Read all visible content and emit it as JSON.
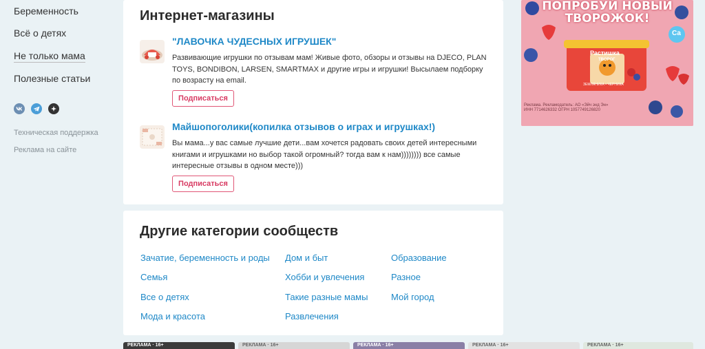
{
  "sidebar": {
    "links": [
      "Беременность",
      "Всё о детях",
      "Не только мама",
      "Полезные статьи"
    ],
    "social_icons": [
      "vk-icon",
      "telegram-icon",
      "ok-icon"
    ],
    "small_links": [
      "Техническая поддержка",
      "Реклама на сайте"
    ]
  },
  "shops": {
    "title": "Интернет-магазины",
    "items": [
      {
        "name": "\"ЛАВОЧКА ЧУДЕСНЫХ ИГРУШЕК\"",
        "description": "Развивающие игрушки по отзывам мам! Живые фото, обзоры и отзывы на DJECO, PLAN TOYS, BONDIBON, LARSEN, SMARTMAX и другие игры и игрушки! Высылаем подборку по возрасту на email.",
        "button": "Подписаться"
      },
      {
        "name": "Майшопоголики(копилка отзывов о играх и игрушках!)",
        "description": "Вы мама...у вас самые лучшие дети...вам хочется радовать своих детей интересными книгами и игрушками но выбор такой огромный? тогда вам к нам)))))))) все самые интересные отзывы в одном месте)))",
        "button": "Подписаться"
      }
    ]
  },
  "other": {
    "title": "Другие категории сообществ",
    "col1": [
      "Зачатие, беременность и роды",
      "Семья",
      "Все о детях",
      "Мода и красота"
    ],
    "col2": [
      "Дом и быт",
      "Хобби и увлечения",
      "Такие разные мамы",
      "Развлечения"
    ],
    "col3": [
      "Образование",
      "Разное",
      "Мой город"
    ]
  },
  "ad": {
    "headline": "ПОПРОБУЙ НОВЫЙ ТВОРОЖОК!",
    "brand": "Растишка",
    "product": "ТВОРОГ",
    "flavor": "ЗЕМЛЯНИКА • ЧЕРНИКА",
    "badge": "Са",
    "legal": "Реклама. Рекламодатель: АО «Эйч энд Эн» ИНН 7714626332 ОГРН 1057749126820",
    "colors": {
      "background": "#f0a6b2",
      "title_shadow": "#c0283d"
    }
  },
  "bottom_ads": {
    "label": "РЕКЛАМА · 16+",
    "count": 5
  },
  "colors": {
    "link": "#1e88c7",
    "button_border": "#e05575",
    "page_bg": "#eaf2f5"
  }
}
